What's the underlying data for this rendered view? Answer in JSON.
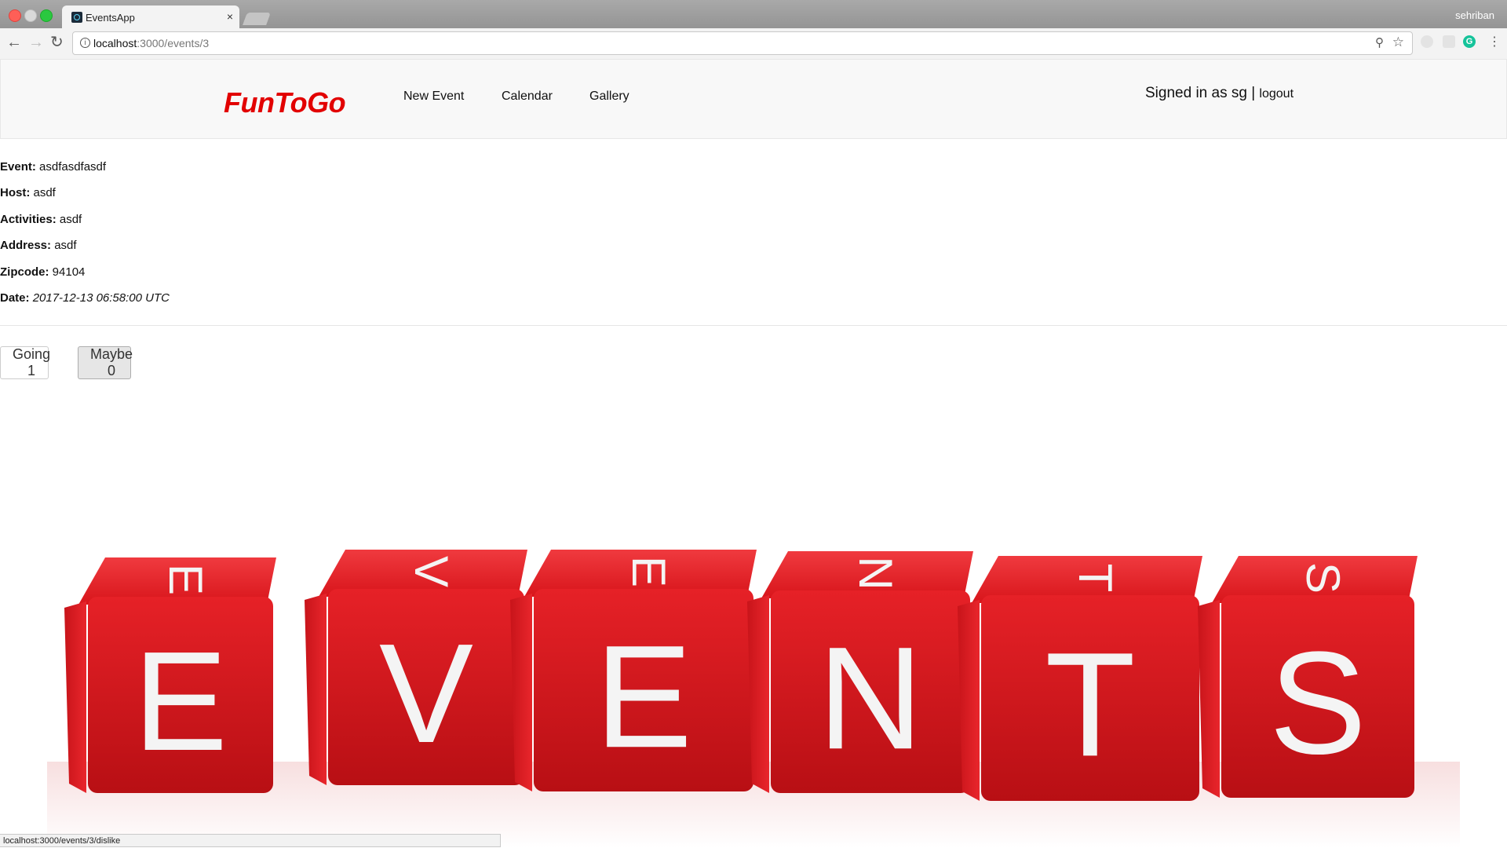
{
  "browser": {
    "tab_title": "EventsApp",
    "tab_close": "×",
    "profile_name": "sehriban",
    "url_host": "localhost",
    "url_path": ":3000/events/3",
    "info_glyph": "i",
    "status_url": "localhost:3000/events/3/dislike",
    "icons": {
      "back": "arrow-left-icon",
      "forward": "arrow-right-icon",
      "reload": "reload-icon",
      "zoom": "zoom-icon",
      "bookmark": "star-icon",
      "menu": "kebab-menu-icon"
    },
    "extension_g": "G"
  },
  "navbar": {
    "brand": "FunToGo",
    "brand_color": "#e20000",
    "links": [
      "New Event",
      "Calendar",
      "Gallery"
    ],
    "signed_in_text": "Signed in as sg",
    "separator": "|",
    "logout": "logout"
  },
  "event": {
    "fields": [
      {
        "label": "Event:",
        "value": "asdfasdfasdf"
      },
      {
        "label": "Host:",
        "value": "asdf"
      },
      {
        "label": "Activities:",
        "value": "asdf"
      },
      {
        "label": "Address:",
        "value": "asdf"
      },
      {
        "label": "Zipcode:",
        "value": "94104"
      },
      {
        "label": "Date:",
        "value": "2017-12-13 06:58:00 UTC"
      }
    ]
  },
  "rsvp": {
    "going_label": "Going 1",
    "maybe_label": "Maybe 0"
  },
  "hero": {
    "letters": [
      "E",
      "V",
      "E",
      "N",
      "T",
      "S"
    ],
    "cube_color": "#d8151b"
  }
}
